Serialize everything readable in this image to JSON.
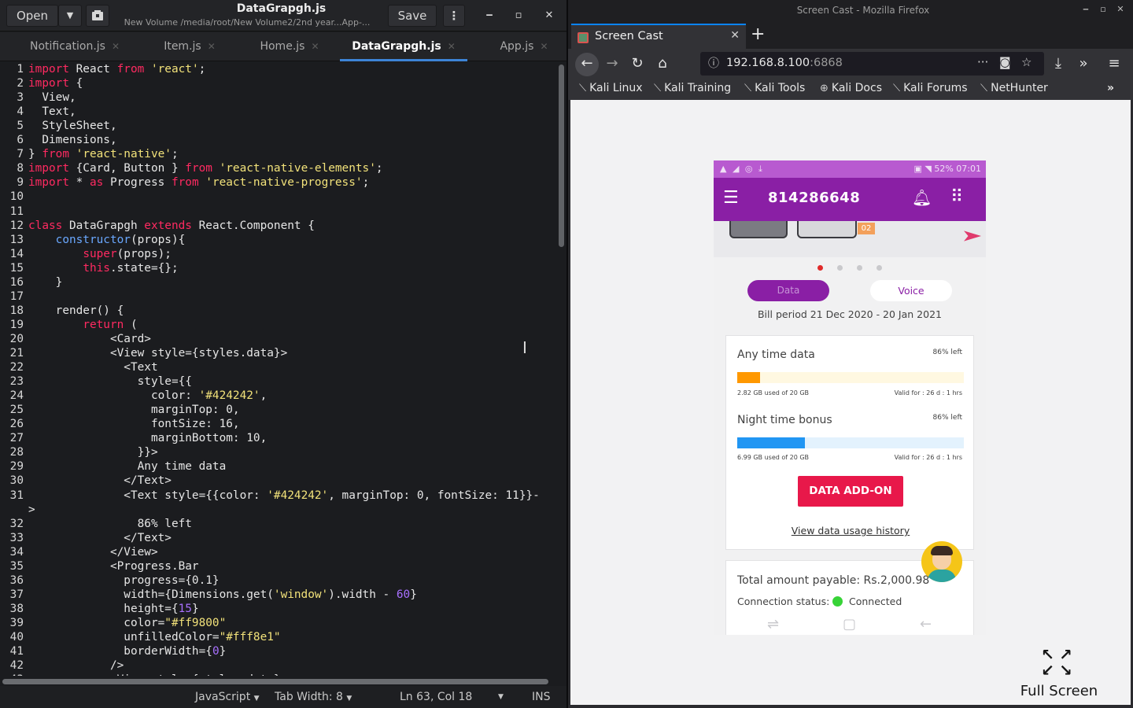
{
  "editor": {
    "open_label": "Open",
    "open_dropdown_icon": "▼",
    "save_label": "Save",
    "title": "DataGrapgh.js",
    "path": "New Volume /media/root/New Volume2/2nd year...App-...",
    "tabs": [
      {
        "label": "Notification.js",
        "active": false
      },
      {
        "label": "Item.js",
        "active": false
      },
      {
        "label": "Home.js",
        "active": false
      },
      {
        "label": "DataGrapgh.js",
        "active": true
      },
      {
        "label": "App.js",
        "active": false
      }
    ],
    "status": {
      "language": "JavaScript",
      "tab_width": "Tab Width: 8",
      "position": "Ln 63, Col 18",
      "mode": "INS"
    }
  },
  "code_lines": [
    {
      "n": "1",
      "t": [
        [
          "kw",
          "import"
        ],
        [
          "tx",
          " React "
        ],
        [
          "kw",
          "from"
        ],
        [
          "tx",
          " "
        ],
        [
          "str",
          "'react'"
        ],
        [
          "tx",
          ";"
        ]
      ]
    },
    {
      "n": "2",
      "t": [
        [
          "kw",
          "import"
        ],
        [
          "tx",
          " {"
        ]
      ]
    },
    {
      "n": "3",
      "t": [
        [
          "tx",
          "  View,"
        ]
      ]
    },
    {
      "n": "4",
      "t": [
        [
          "tx",
          "  Text,"
        ]
      ]
    },
    {
      "n": "5",
      "t": [
        [
          "tx",
          "  StyleSheet,"
        ]
      ]
    },
    {
      "n": "6",
      "t": [
        [
          "tx",
          "  Dimensions,"
        ]
      ]
    },
    {
      "n": "7",
      "t": [
        [
          "tx",
          "} "
        ],
        [
          "kw",
          "from"
        ],
        [
          "tx",
          " "
        ],
        [
          "str",
          "'react-native'"
        ],
        [
          "tx",
          ";"
        ]
      ]
    },
    {
      "n": "8",
      "t": [
        [
          "kw",
          "import"
        ],
        [
          "tx",
          " {Card, Button } "
        ],
        [
          "kw",
          "from"
        ],
        [
          "tx",
          " "
        ],
        [
          "str",
          "'react-native-elements'"
        ],
        [
          "tx",
          ";"
        ]
      ]
    },
    {
      "n": "9",
      "t": [
        [
          "kw",
          "import"
        ],
        [
          "tx",
          " * "
        ],
        [
          "kw",
          "as"
        ],
        [
          "tx",
          " Progress "
        ],
        [
          "kw",
          "from"
        ],
        [
          "tx",
          " "
        ],
        [
          "str",
          "'react-native-progress'"
        ],
        [
          "tx",
          ";"
        ]
      ]
    },
    {
      "n": "10",
      "t": []
    },
    {
      "n": "11",
      "t": []
    },
    {
      "n": "12",
      "t": [
        [
          "kw",
          "class"
        ],
        [
          "tx",
          " DataGrapgh "
        ],
        [
          "kw",
          "extends"
        ],
        [
          "tx",
          " React.Component {"
        ]
      ]
    },
    {
      "n": "13",
      "t": [
        [
          "tx",
          "    "
        ],
        [
          "cls",
          "constructor"
        ],
        [
          "tx",
          "(props){"
        ]
      ]
    },
    {
      "n": "14",
      "t": [
        [
          "tx",
          "        "
        ],
        [
          "kw",
          "super"
        ],
        [
          "tx",
          "(props);"
        ]
      ]
    },
    {
      "n": "15",
      "t": [
        [
          "tx",
          "        "
        ],
        [
          "kw",
          "this"
        ],
        [
          "tx",
          ".state={};"
        ]
      ]
    },
    {
      "n": "16",
      "t": [
        [
          "tx",
          "    }"
        ]
      ]
    },
    {
      "n": "17",
      "t": []
    },
    {
      "n": "18",
      "t": [
        [
          "tx",
          "    render() {"
        ]
      ]
    },
    {
      "n": "19",
      "t": [
        [
          "tx",
          "        "
        ],
        [
          "kw",
          "return"
        ],
        [
          "tx",
          " ("
        ]
      ]
    },
    {
      "n": "20",
      "t": [
        [
          "tx",
          "            <Card>"
        ]
      ]
    },
    {
      "n": "21",
      "t": [
        [
          "tx",
          "            <View style={styles.data}>"
        ]
      ]
    },
    {
      "n": "22",
      "t": [
        [
          "tx",
          "              <Text"
        ]
      ]
    },
    {
      "n": "23",
      "t": [
        [
          "tx",
          "                style={{"
        ]
      ]
    },
    {
      "n": "24",
      "t": [
        [
          "tx",
          "                  color: "
        ],
        [
          "str",
          "'#424242'"
        ],
        [
          "tx",
          ","
        ]
      ]
    },
    {
      "n": "25",
      "t": [
        [
          "tx",
          "                  marginTop: 0,"
        ]
      ]
    },
    {
      "n": "26",
      "t": [
        [
          "tx",
          "                  fontSize: 16,"
        ]
      ]
    },
    {
      "n": "27",
      "t": [
        [
          "tx",
          "                  marginBottom: 10,"
        ]
      ]
    },
    {
      "n": "28",
      "t": [
        [
          "tx",
          "                }}>"
        ]
      ]
    },
    {
      "n": "29",
      "t": [
        [
          "tx",
          "                Any time data"
        ]
      ]
    },
    {
      "n": "30",
      "t": [
        [
          "tx",
          "              </Text>"
        ]
      ]
    },
    {
      "n": "31",
      "t": [
        [
          "tx",
          "              <Text style={{color: "
        ],
        [
          "str",
          "'#424242'"
        ],
        [
          "tx",
          ", marginTop: 0, fontSize: 11}}-"
        ]
      ]
    },
    {
      "n": "",
      "t": [
        [
          "tx",
          ">"
        ]
      ]
    },
    {
      "n": "32",
      "t": [
        [
          "tx",
          "                86% left"
        ]
      ]
    },
    {
      "n": "33",
      "t": [
        [
          "tx",
          "              </Text>"
        ]
      ]
    },
    {
      "n": "34",
      "t": [
        [
          "tx",
          "            </View>"
        ]
      ]
    },
    {
      "n": "35",
      "t": [
        [
          "tx",
          "            <Progress.Bar"
        ]
      ]
    },
    {
      "n": "36",
      "t": [
        [
          "tx",
          "              progress={0.1}"
        ]
      ]
    },
    {
      "n": "37",
      "t": [
        [
          "tx",
          "              width={Dimensions.get("
        ],
        [
          "str",
          "'window'"
        ],
        [
          "tx",
          ").width - "
        ],
        [
          "num",
          "60"
        ],
        [
          "tx",
          "}"
        ]
      ]
    },
    {
      "n": "38",
      "t": [
        [
          "tx",
          "              height={"
        ],
        [
          "num",
          "15"
        ],
        [
          "tx",
          "}"
        ]
      ]
    },
    {
      "n": "39",
      "t": [
        [
          "tx",
          "              color="
        ],
        [
          "str",
          "\"#ff9800\""
        ]
      ]
    },
    {
      "n": "40",
      "t": [
        [
          "tx",
          "              unfilledColor="
        ],
        [
          "str",
          "\"#fff8e1\""
        ]
      ]
    },
    {
      "n": "41",
      "t": [
        [
          "tx",
          "              borderWidth={"
        ],
        [
          "num",
          "0"
        ],
        [
          "tx",
          "}"
        ]
      ]
    },
    {
      "n": "42",
      "t": [
        [
          "tx",
          "            />"
        ]
      ]
    },
    {
      "n": "43",
      "t": [
        [
          "tx",
          "            <View style={styles.data}>"
        ]
      ]
    }
  ],
  "browser": {
    "window_title": "Screen Cast - Mozilla Firefox",
    "tab_title": "Screen Cast",
    "url_host": "192.168.8.100",
    "url_port": ":6868",
    "bookmarks": [
      "Kali Linux",
      "Kali Training",
      "Kali Tools",
      "Kali Docs",
      "Kali Forums",
      "NetHunter"
    ],
    "fullscreen_label": "Full Screen"
  },
  "phone": {
    "status_right": "52% 07:01",
    "number": "814286648",
    "toggle_data": "Data",
    "toggle_voice": "Voice",
    "bill_period": "Bill period 21 Dec 2020 - 20 Jan 2021",
    "banner_tag": "02",
    "carousel_active_index": 0,
    "anytime": {
      "title": "Any time data",
      "left": "86% left",
      "used": "2.82 GB used of 20 GB",
      "valid": "Valid for : 26 d : 1 hrs",
      "fill_fraction": 0.1,
      "fill_color": "#ff9800"
    },
    "night": {
      "title": "Night time bonus",
      "left": "86% left",
      "used": "6.99 GB used of 20 GB",
      "valid": "Valid for : 26 d : 1 hrs",
      "fill_fraction": 0.3,
      "fill_color": "#2196f3"
    },
    "addon_label": "DATA ADD-ON",
    "usage_link": "View data usage history",
    "total": "Total amount payable: Rs.2,000.98",
    "connection_label": "Connection status:",
    "connection_value": "Connected"
  },
  "colors": {
    "keyword": "#ff2a61",
    "string": "#f2e27a",
    "app_purple": "#8a1fa5",
    "addon_red": "#e8184a",
    "connected_green": "#37d337"
  }
}
